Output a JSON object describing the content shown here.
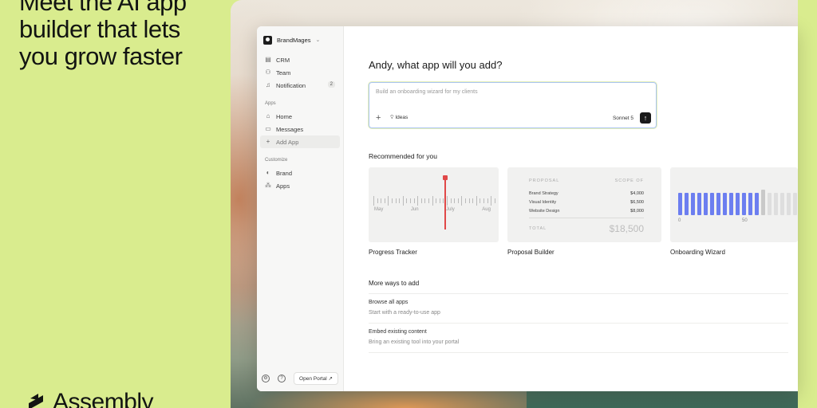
{
  "hero": {
    "headline_lines": [
      "Meet the AI app",
      "builder that lets",
      "you grow faster"
    ],
    "brand_name": "Assembly"
  },
  "sidebar": {
    "workspace": "BrandMages",
    "items": [
      {
        "label": "CRM",
        "icon": "crm-icon"
      },
      {
        "label": "Team",
        "icon": "team-icon"
      },
      {
        "label": "Notification",
        "icon": "bell-icon",
        "badge": "2"
      }
    ],
    "apps_section": "Apps",
    "apps_items": [
      {
        "label": "Home",
        "icon": "home-icon"
      },
      {
        "label": "Messages",
        "icon": "message-icon"
      },
      {
        "label": "Add App",
        "icon": "plus-icon",
        "active": true
      }
    ],
    "customize_section": "Customize",
    "customize_items": [
      {
        "label": "Brand",
        "icon": "palette-icon"
      },
      {
        "label": "Apps",
        "icon": "apps-icon"
      }
    ],
    "open_portal": "Open Portal ↗"
  },
  "main": {
    "title": "Andy, what app will you add?",
    "prompt_placeholder": "Build an onboarding wizard for my clients",
    "ideas_label": "Ideas",
    "model_label": "Sonnet 5",
    "recommended_title": "Recommended for you",
    "cards": [
      {
        "label": "Progress Tracker",
        "months": [
          "May",
          "Jun",
          "July",
          "Aug"
        ]
      },
      {
        "label": "Proposal Builder",
        "proposal": {
          "header_left": "PROPOSAL",
          "header_right": "SCOPE OF",
          "rows": [
            {
              "name": "Brand Strategy",
              "amount": "$4,000"
            },
            {
              "name": "Visual Identity",
              "amount": "$6,500"
            },
            {
              "name": "Website Design",
              "amount": "$8,000"
            }
          ],
          "total_label": "TOTAL",
          "total_value": "$18,500"
        }
      },
      {
        "label": "Onboarding Wizard",
        "axis": [
          "0",
          "50"
        ],
        "progress_fraction": 0.6
      }
    ],
    "more_title": "More ways to add",
    "more_items": [
      {
        "title": "Browse all apps",
        "subtitle": "Start with a ready-to-use app"
      },
      {
        "title": "Embed existing content",
        "subtitle": "Bring an existing tool into your portal"
      }
    ]
  },
  "colors": {
    "background": "#d9ec8e",
    "accent_blue": "#6c7ef0",
    "marker_red": "#e04848"
  }
}
